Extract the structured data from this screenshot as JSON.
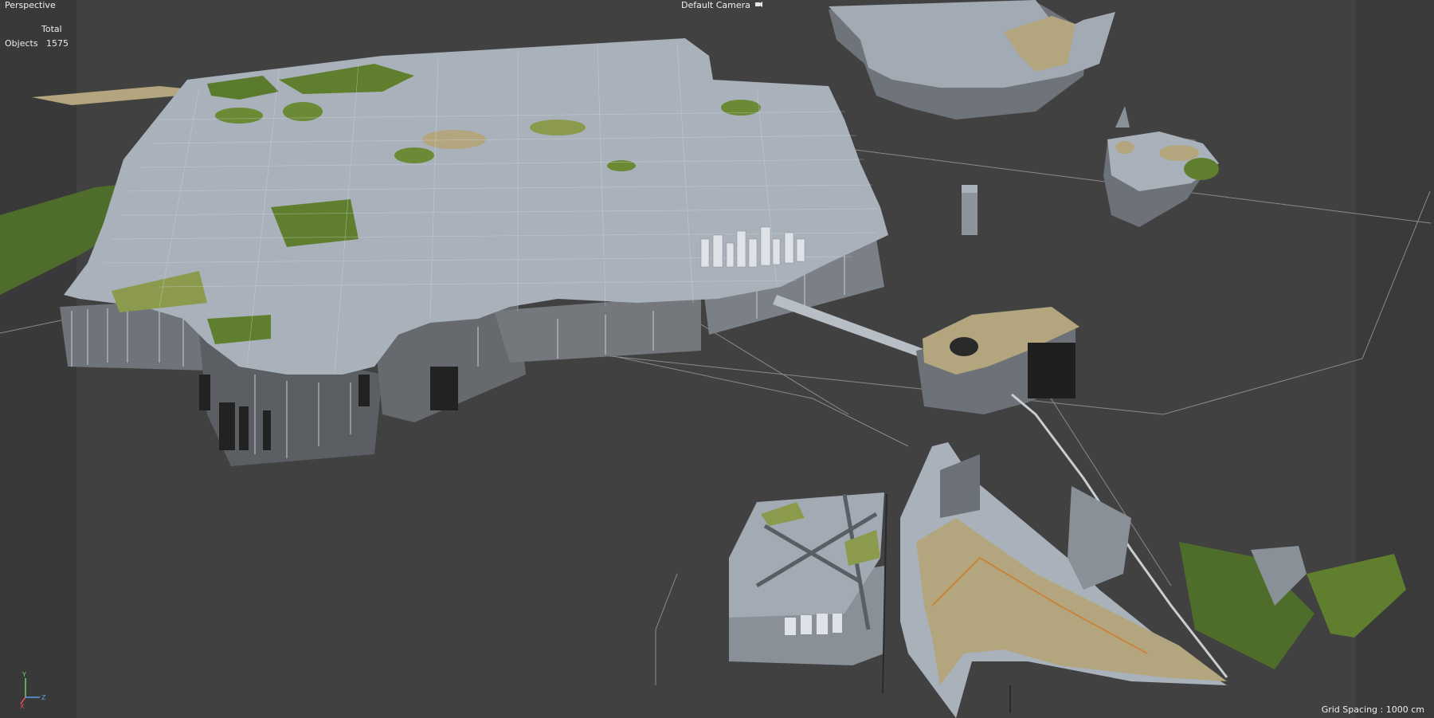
{
  "viewport": {
    "view_name": "Perspective",
    "camera_label": "Default Camera",
    "stats": {
      "header": "Total",
      "objects_label": "Objects",
      "objects_value": "1575"
    },
    "grid_spacing": "Grid Spacing : 1000 cm",
    "axis_labels": {
      "y": "Y",
      "z": "Z",
      "x": "X"
    }
  },
  "colors": {
    "viewport_bg": "#414141",
    "terrain_gray": "#a7b0ba",
    "grass_green": "#5f7f2e",
    "sand_tan": "#b3a67e",
    "road_orange": "#c8843a",
    "axis_y": "#6fd06f",
    "axis_z": "#5aa0e0",
    "axis_x": "#e05050"
  },
  "icons": [
    "camera-icon"
  ]
}
